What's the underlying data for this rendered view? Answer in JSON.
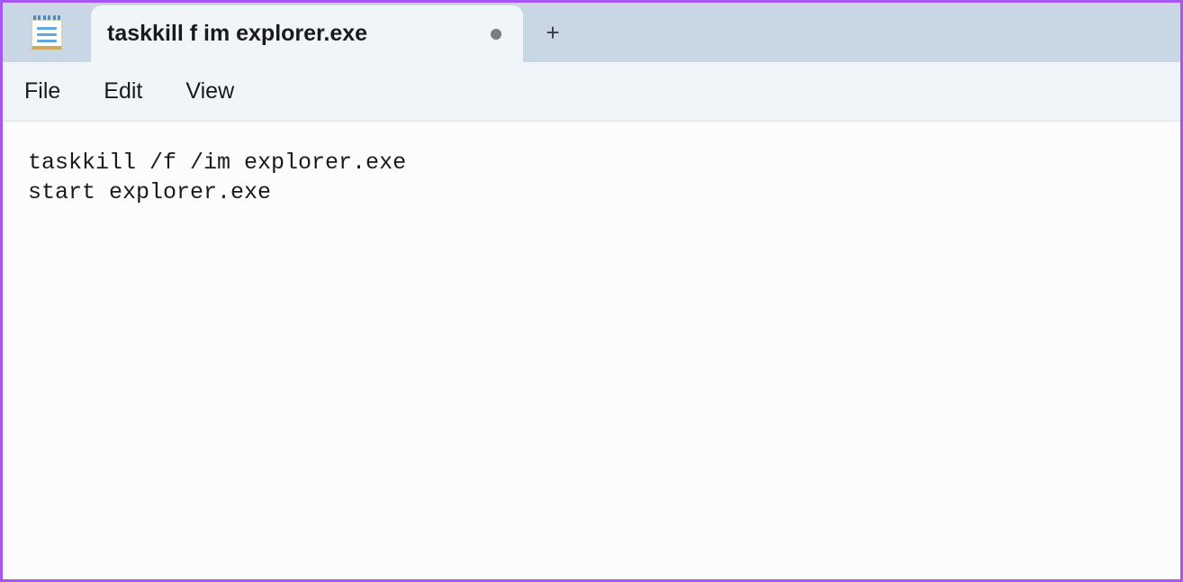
{
  "tabs": [
    {
      "title": "taskkill f im explorer.exe",
      "modified": true
    }
  ],
  "menu": {
    "file": "File",
    "edit": "Edit",
    "view": "View"
  },
  "editor": {
    "content": "taskkill /f /im explorer.exe\nstart explorer.exe"
  }
}
